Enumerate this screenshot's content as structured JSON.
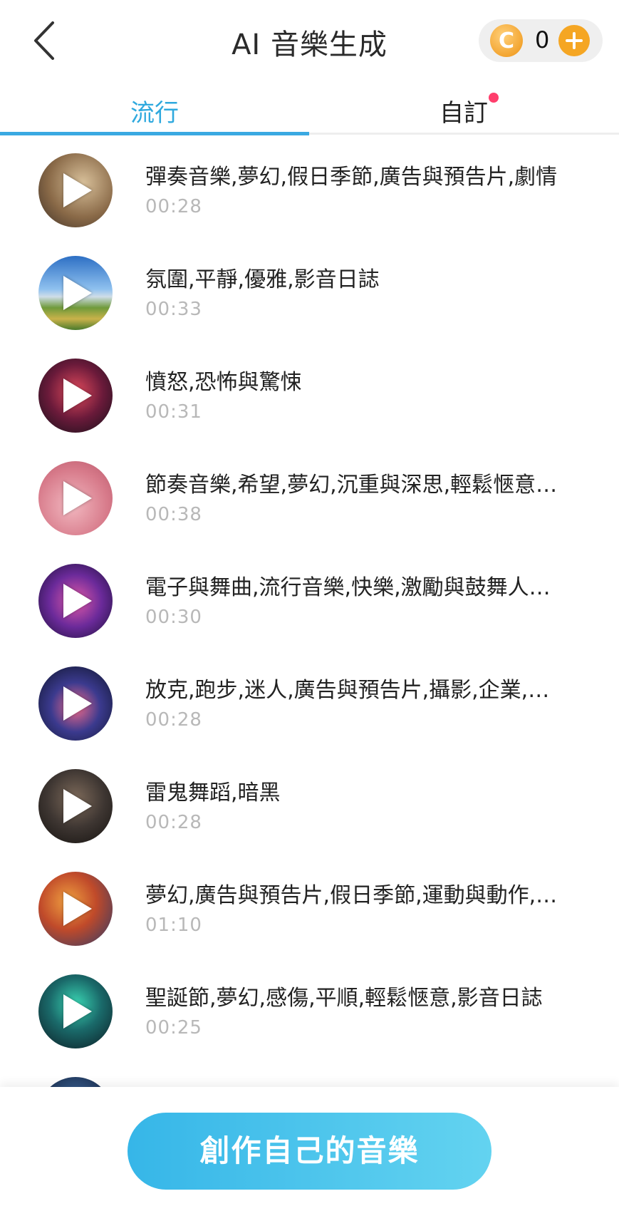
{
  "header": {
    "title": "AI 音樂生成",
    "coin_symbol": "C",
    "coin_count": "0"
  },
  "tabs": [
    {
      "label": "流行",
      "active": true
    },
    {
      "label": "自訂",
      "active": false,
      "has_dot": true
    }
  ],
  "items": [
    {
      "title": "彈奏音樂,夢幻,假日季節,廣告與預告片,劇情",
      "duration": "00:28"
    },
    {
      "title": "氛圍,平靜,優雅,影音日誌",
      "duration": "00:33"
    },
    {
      "title": "憤怒,恐怖與驚悚",
      "duration": "00:31"
    },
    {
      "title": "節奏音樂,希望,夢幻,沉重與深思,輕鬆愜意…",
      "duration": "00:38"
    },
    {
      "title": "電子與舞曲,流行音樂,快樂,激勵與鼓舞人…",
      "duration": "00:30"
    },
    {
      "title": "放克,跑步,迷人,廣告與預告片,攝影,企業,…",
      "duration": "00:28"
    },
    {
      "title": "雷鬼舞蹈,暗黑",
      "duration": "00:28"
    },
    {
      "title": "夢幻,廣告與預告片,假日季節,運動與動作,…",
      "duration": "01:10"
    },
    {
      "title": "聖誕節,夢幻,感傷,平順,輕鬆愜意,影音日誌",
      "duration": "00:25"
    }
  ],
  "create_button": "創作自己的音樂",
  "colors": {
    "accent": "#3aa9e2",
    "badge": "#ff3e6c",
    "coin": "#f5a623"
  }
}
